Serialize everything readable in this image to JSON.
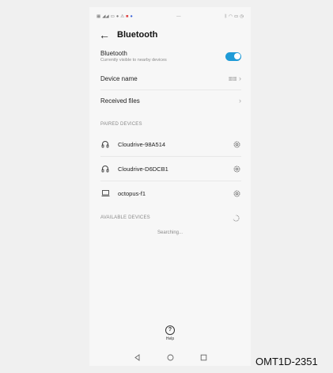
{
  "header": {
    "title": "Bluetooth"
  },
  "bluetooth": {
    "label": "Bluetooth",
    "sublabel": "Currently visible to nearby devices",
    "enabled": true,
    "accent_color": "#1f9bd7"
  },
  "device_name": {
    "label": "Device name"
  },
  "received_files": {
    "label": "Received files"
  },
  "paired": {
    "section_label": "PAIRED DEVICES",
    "devices": [
      {
        "name": "Cloudrive-98A514",
        "icon": "headphones-icon"
      },
      {
        "name": "Cloudrive-D6DCB1",
        "icon": "headphones-icon"
      },
      {
        "name": "octopus-f1",
        "icon": "laptop-icon"
      }
    ]
  },
  "available": {
    "section_label": "AVAILABLE DEVICES",
    "status": "Searching..."
  },
  "help": {
    "label": "Help",
    "glyph": "?"
  },
  "caption": "OMT1D-2351"
}
